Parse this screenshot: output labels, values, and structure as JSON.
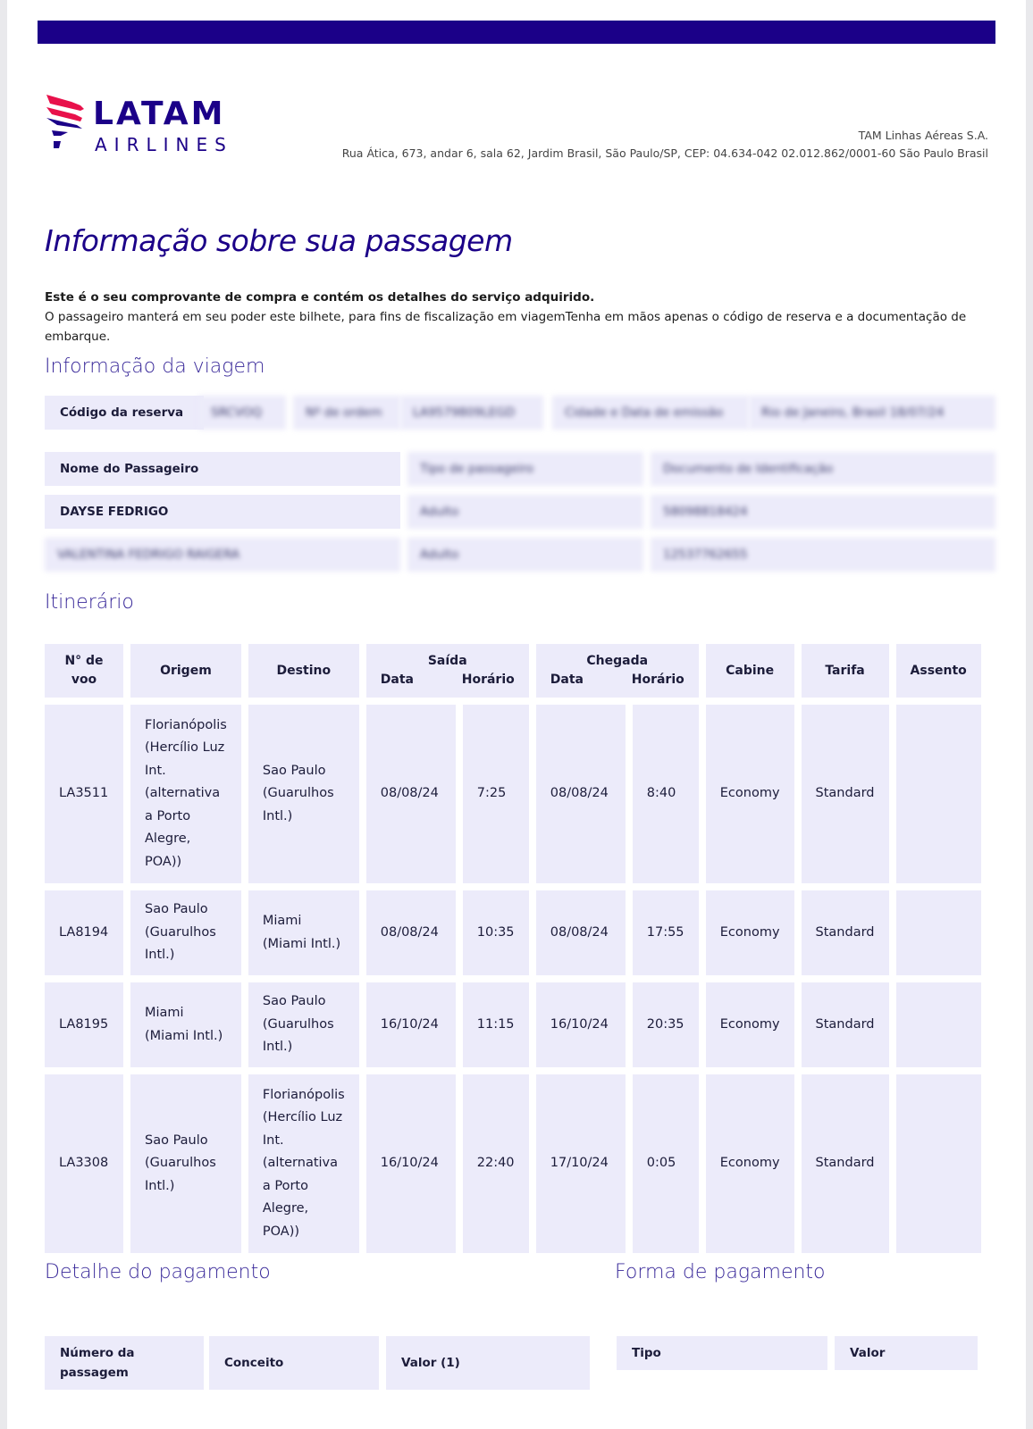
{
  "header": {
    "logo_line1": "LATAM",
    "logo_line2": "AIRLINES",
    "company_name": "TAM Linhas Aéreas S.A.",
    "company_address": "Rua Ática, 673, andar 6, sala 62, Jardim Brasil, São Paulo/SP, CEP: 04.634-042 02.012.862/0001-60 São Paulo Brasil"
  },
  "title": "Informação sobre sua passagem",
  "intro": {
    "bold": "Este é o seu comprovante de compra e contém os detalhes do serviço adquirido.",
    "text": "O passageiro manterá em seu poder este bilhete, para fins de fiscalização em viagemTenha em mãos apenas o código de reserva e a documentação de embarque."
  },
  "trip_info": {
    "heading": "Informação da viagem",
    "reservation_label": "Código da reserva",
    "blurred": [
      "SRCVOQ",
      "Nº de ordem",
      "LA9579809LEGD",
      "Cidade e Data de emissão",
      "Rio de Janeiro, Brasil 18/07/24"
    ]
  },
  "passengers": {
    "name_label": "Nome do Passageiro",
    "type_label_blurred": "Tipo de passageiro",
    "doc_label_blurred": "Documento de Identificação",
    "rows": [
      {
        "name": "DAYSE FEDRIGO",
        "type": "Adulto",
        "doc": "58098818424"
      },
      {
        "name": "VALENTINA FEDRIGO RAIGERA",
        "type": "Adulto",
        "doc": "12537762655"
      }
    ]
  },
  "itinerary": {
    "heading": "Itinerário",
    "headers": {
      "flight": "N° de voo",
      "origin": "Origem",
      "destination": "Destino",
      "departure": "Saída",
      "arrival": "Chegada",
      "date": "Data",
      "time": "Horário",
      "cabin": "Cabine",
      "fare": "Tarifa",
      "seat": "Assento"
    },
    "rows": [
      {
        "flight": "LA3511",
        "origin": "Florianópolis (Hercílio Luz Int. (alternativa a Porto Alegre, POA))",
        "destination": "Sao Paulo (Guarulhos Intl.)",
        "dep_date": "08/08/24",
        "dep_time": "7:25",
        "arr_date": "08/08/24",
        "arr_time": "8:40",
        "cabin": "Economy",
        "fare": "Standard",
        "seat": ""
      },
      {
        "flight": "LA8194",
        "origin": "Sao Paulo (Guarulhos Intl.)",
        "destination": "Miami (Miami Intl.)",
        "dep_date": "08/08/24",
        "dep_time": "10:35",
        "arr_date": "08/08/24",
        "arr_time": "17:55",
        "cabin": "Economy",
        "fare": "Standard",
        "seat": ""
      },
      {
        "flight": "LA8195",
        "origin": "Miami (Miami Intl.)",
        "destination": "Sao Paulo (Guarulhos Intl.)",
        "dep_date": "16/10/24",
        "dep_time": "11:15",
        "arr_date": "16/10/24",
        "arr_time": "20:35",
        "cabin": "Economy",
        "fare": "Standard",
        "seat": ""
      },
      {
        "flight": "LA3308",
        "origin": "Sao Paulo (Guarulhos Intl.)",
        "destination": "Florianópolis (Hercílio Luz Int. (alternativa a Porto Alegre, POA))",
        "dep_date": "16/10/24",
        "dep_time": "22:40",
        "arr_date": "17/10/24",
        "arr_time": "0:05",
        "cabin": "Economy",
        "fare": "Standard",
        "seat": ""
      }
    ]
  },
  "payment_detail": {
    "heading": "Detalhe do pagamento",
    "col_ticket": "Número da passagem",
    "col_concept": "Conceito",
    "col_value": "Valor (1)"
  },
  "payment_method": {
    "heading": "Forma de pagamento",
    "col_type": "Tipo",
    "col_value": "Valor"
  },
  "colors": {
    "brand": "#1b0088",
    "cell_bg": "#ecebfa",
    "logo_red": "#e8114b"
  }
}
